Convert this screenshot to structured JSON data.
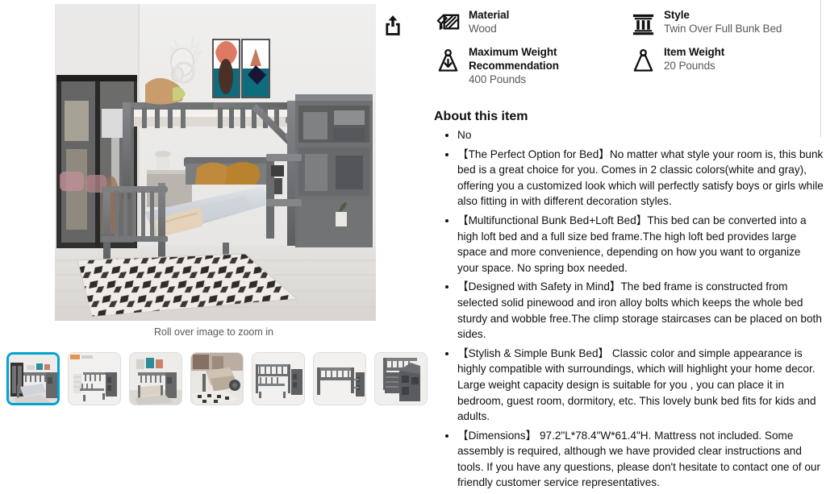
{
  "gallery": {
    "share_icon": "share-icon",
    "rollover_hint": "Roll over image to zoom in",
    "thumbnails": [
      {
        "alt": "Bunk bed in styled bedroom with artwork",
        "selected": true
      },
      {
        "alt": "Twin over full bunk bed with staircase, white background",
        "selected": false
      },
      {
        "alt": "Bunk bed with bedding in room setting",
        "selected": false
      },
      {
        "alt": "Close up of lower full bed with pillows",
        "selected": false
      },
      {
        "alt": "Bunk bed product shot side angle",
        "selected": false
      },
      {
        "alt": "High loft bed configuration with storage stairs",
        "selected": false
      },
      {
        "alt": "Storage staircase detail view",
        "selected": false
      }
    ]
  },
  "specs": [
    {
      "icon": "material-swatch-icon",
      "label": "Material",
      "value": "Wood"
    },
    {
      "icon": "column-style-icon",
      "label": "Style",
      "value": "Twin Over Full Bunk Bed"
    },
    {
      "icon": "max-weight-icon",
      "label": "Maximum Weight Recommendation",
      "value": "400 Pounds"
    },
    {
      "icon": "item-weight-icon",
      "label": "Item Weight",
      "value": "20 Pounds"
    }
  ],
  "about": {
    "title": "About this item",
    "bullets": [
      "No",
      "【The Perfect Option for Bed】No matter what style your room is, this bunk bed is a great choice for you. Comes in 2 classic colors(white and gray), offering you a customized look which will perfectly satisfy boys or girls while also fitting in with different decoration styles.",
      "【Multifunctional Bunk Bed+Loft Bed】This bed can be converted into a high loft bed and a full size bed frame.The high loft bed provides large space and more convenience, depending on how you want to organize your space. No spring box needed.",
      "【Designed with Safety in Mind】The bed frame is constructed from selected solid pinewood and iron alloy bolts which keeps the whole bed sturdy and wobble free.The climp storage staircases can be placed on both sides.",
      "【Stylish & Simple Bunk Bed】 Classic color and simple appearance is highly compatible with surroundings, which will highlight your home decor. Large weight capacity design is suitable for you , you can place it in bedroom, guest room, dormitory, etc. This lovely bunk bed fits for kids and adults.",
      "【Dimensions】 97.2\"L*78.4\"W*61.4\"H. Mattress not included. Some assembly is required, although we have provided clear instructions and tools. If you have any questions, please don't hesitate to contact one of our friendly customer service representatives."
    ]
  },
  "colors": {
    "selected_thumb_border": "#00a4cf",
    "label_text": "#0f1111",
    "value_text": "#565959",
    "divider": "#d5d9d9"
  }
}
